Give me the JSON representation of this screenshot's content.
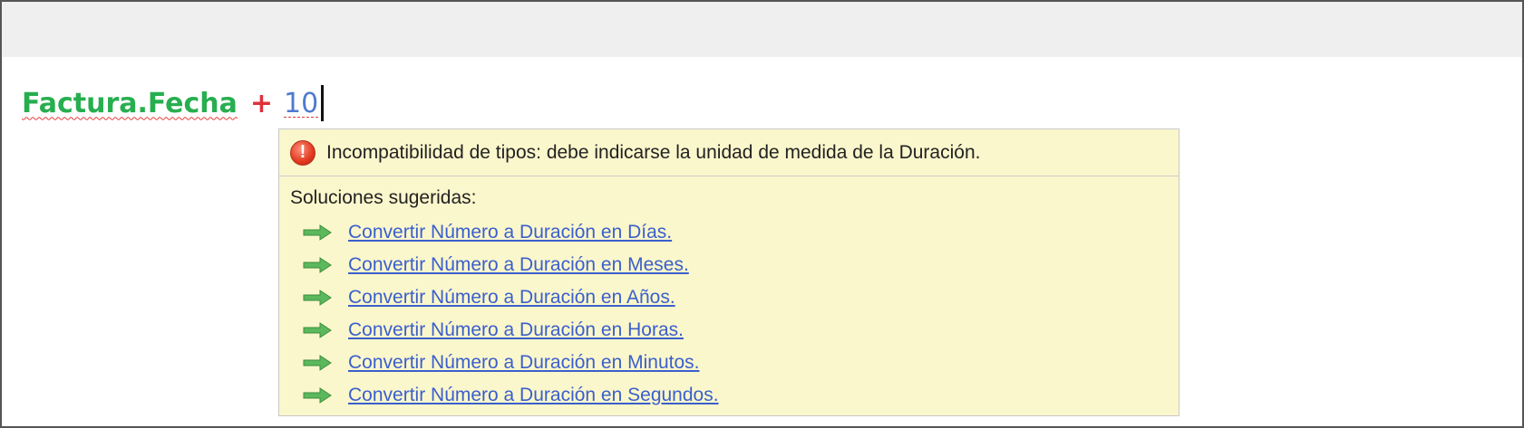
{
  "editor": {
    "expression": "Factura.Fecha",
    "operator": "+",
    "number": "10"
  },
  "popup": {
    "error_icon_symbol": "!",
    "error_message": "Incompatibilidad de tipos: debe indicarse la unidad de medida de la Duración.",
    "suggestions_title": "Soluciones sugeridas:",
    "suggestions": [
      "Convertir Número a Duración en Días.",
      "Convertir Número a Duración en Meses.",
      "Convertir Número a Duración en Años.",
      "Convertir Número a Duración en Horas.",
      "Convertir Número a Duración en Minutos.",
      "Convertir Número a Duración en Segundos."
    ]
  },
  "icons": {
    "error": "error-circle-icon",
    "suggestion": "green-arrow-right-icon"
  },
  "colors": {
    "expression": "#27ae4f",
    "operator": "#e0313a",
    "number": "#4f7bd0",
    "popup_bg": "#fbf7cc",
    "link": "#3a5fcd",
    "error_icon": "#e0391f",
    "arrow": "#5cb85c"
  }
}
